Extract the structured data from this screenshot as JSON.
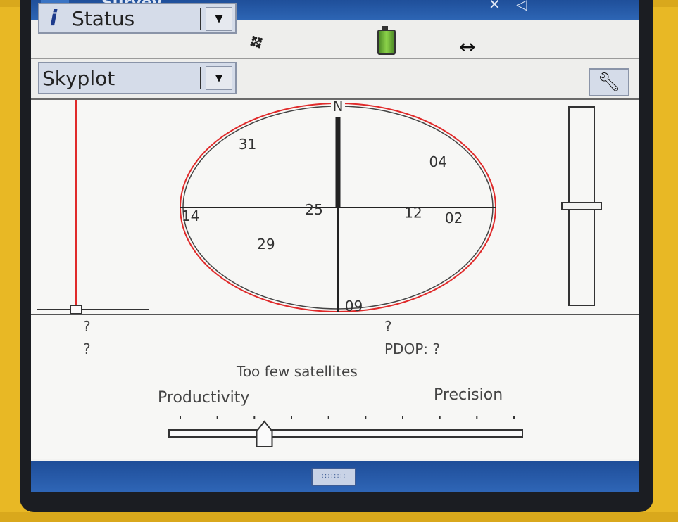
{
  "window": {
    "title": "Survey..."
  },
  "toolbar": {
    "status_dropdown": {
      "icon": "info-icon",
      "label": "Status"
    },
    "icons": [
      "satellite-icon",
      "battery-icon",
      "connection-arrows-icon"
    ]
  },
  "view_dropdown": {
    "label": "Skyplot",
    "settings_icon": "wrench-icon"
  },
  "skyplot": {
    "north_label": "N",
    "satellites": [
      {
        "id": "31",
        "azimuth": 317,
        "elevation": 13
      },
      {
        "id": "04",
        "azimuth": 55,
        "elevation": 19
      },
      {
        "id": "25",
        "azimuth": 262,
        "elevation": 76
      },
      {
        "id": "12",
        "azimuth": 96,
        "elevation": 46
      },
      {
        "id": "02",
        "azimuth": 98,
        "elevation": 22
      },
      {
        "id": "14",
        "azimuth": 265,
        "elevation": 4
      },
      {
        "id": "29",
        "azimuth": 232,
        "elevation": 37
      },
      {
        "id": "09",
        "azimuth": 174,
        "elevation": 2
      }
    ]
  },
  "position_info": {
    "left_line1": "?",
    "left_line2": "?",
    "right_line1": "?",
    "pdop": "PDOP: ?",
    "message": "Too few satellites"
  },
  "mode_slider": {
    "left_label": "Productivity",
    "right_label": "Precision",
    "ticks": 10,
    "value_fraction": 0.27
  },
  "colors": {
    "accent_red": "#e02a2a",
    "titlebar_blue": "#2a5ba8"
  }
}
